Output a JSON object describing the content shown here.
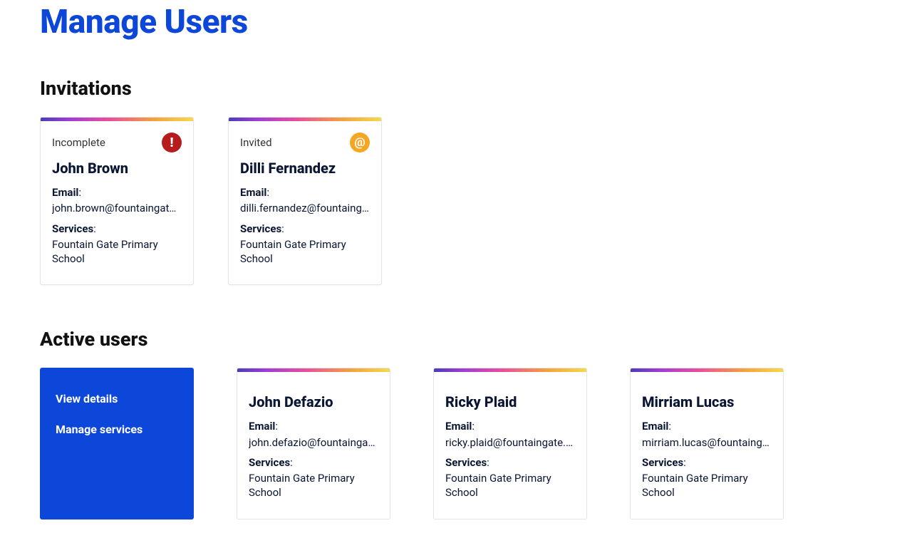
{
  "page_title": "Manage Users",
  "sections": {
    "invitations": {
      "title": "Invitations",
      "cards": [
        {
          "status": "Incomplete",
          "icon": "alert",
          "name": "John Brown",
          "email_label": "Email",
          "email": "john.brown@fountaingate.edu",
          "services_label": "Services",
          "services": "Fountain Gate Primary School"
        },
        {
          "status": "Invited",
          "icon": "at",
          "name": "Dilli Fernandez",
          "email_label": "Email",
          "email": "dilli.fernandez@fountaingate.edu",
          "services_label": "Services",
          "services": "Fountain Gate Primary School"
        }
      ]
    },
    "active": {
      "title": "Active users",
      "menu": {
        "view_details": "View details",
        "manage_services": "Manage services"
      },
      "cards": [
        {
          "name": "John Defazio",
          "email_label": "Email",
          "email": "john.defazio@fountaingate.edu",
          "services_label": "Services",
          "services": "Fountain Gate Primary School"
        },
        {
          "name": "Ricky Plaid",
          "email_label": "Email",
          "email": "ricky.plaid@fountaingate.edu",
          "services_label": "Services",
          "services": "Fountain Gate Primary School"
        },
        {
          "name": "Mirriam Lucas",
          "email_label": "Email",
          "email": "mirriam.lucas@fountaingate.edu",
          "services_label": "Services",
          "services": "Fountain Gate Primary School"
        }
      ]
    }
  }
}
